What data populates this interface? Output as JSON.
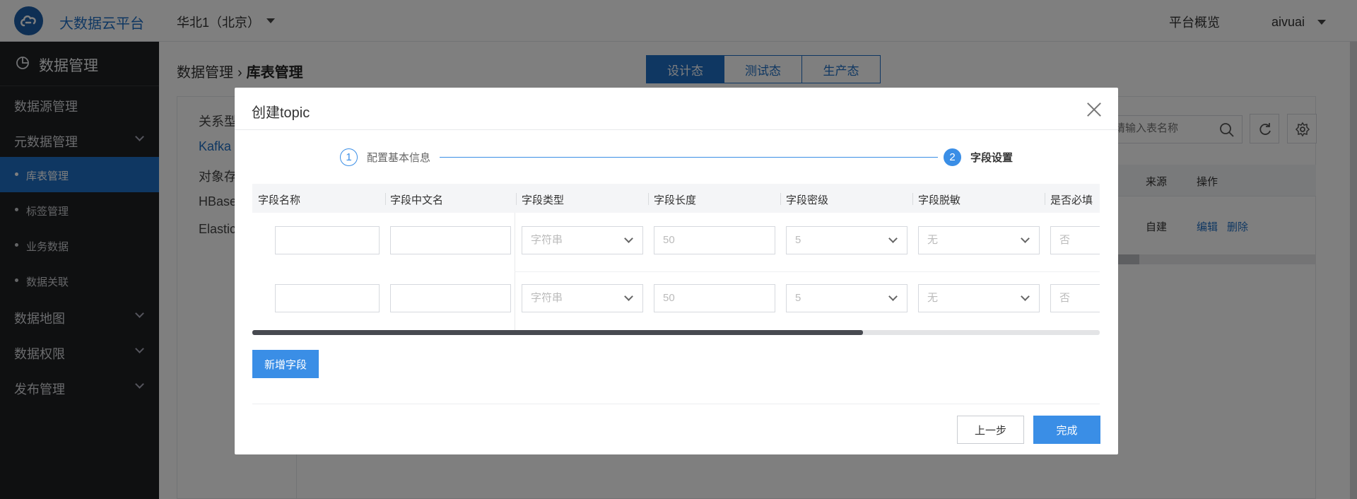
{
  "header": {
    "brand": "大数据云平台",
    "region": "华北1（北京）",
    "overview": "平台概览",
    "username": "aivuai"
  },
  "sidebar": {
    "title": "数据管理",
    "items": [
      {
        "label": "数据源管理"
      },
      {
        "label": "元数据管理",
        "expanded": true
      },
      {
        "label": "库表管理",
        "sub": true,
        "active": true
      },
      {
        "label": "标签管理",
        "sub": true
      },
      {
        "label": "业务数据",
        "sub": true
      },
      {
        "label": "数据关联",
        "sub": true
      },
      {
        "label": "数据地图"
      },
      {
        "label": "数据权限"
      },
      {
        "label": "发布管理"
      }
    ]
  },
  "page": {
    "breadcrumb": {
      "parent": "数据管理",
      "current": "库表管理"
    },
    "env_tabs": [
      "设计态",
      "测试态",
      "生产态"
    ],
    "active_env": "设计态",
    "types": [
      "关系型",
      "Kafka",
      "对象存",
      "HBase",
      "Elastic"
    ],
    "search_placeholder": "请输入表名称",
    "table": {
      "columns": [
        "来源",
        "操作"
      ],
      "row": {
        "source": "自建",
        "edit": "编辑",
        "delete": "删除"
      }
    }
  },
  "modal": {
    "title": "创建topic",
    "steps": [
      {
        "num": "1",
        "label": "配置基本信息",
        "state": "done"
      },
      {
        "num": "2",
        "label": "字段设置",
        "state": "current"
      }
    ],
    "columns": [
      "字段名称",
      "字段中文名",
      "字段类型",
      "字段长度",
      "字段密级",
      "字段脱敏",
      "是否必填"
    ],
    "rows": [
      {
        "name": "",
        "cn_name": "",
        "type": "字符串",
        "length": "50",
        "level": "5",
        "mask": "无",
        "required": "否"
      },
      {
        "name": "",
        "cn_name": "",
        "type": "字符串",
        "length": "50",
        "level": "5",
        "mask": "无",
        "required": "否"
      }
    ],
    "add_field": "新增字段",
    "prev": "上一步",
    "finish": "完成"
  },
  "colors": {
    "primary": "#3a8ee6",
    "brand": "#1f6fc5",
    "sidebar_bg": "#1f2023",
    "active_item": "#1f6fc5"
  }
}
